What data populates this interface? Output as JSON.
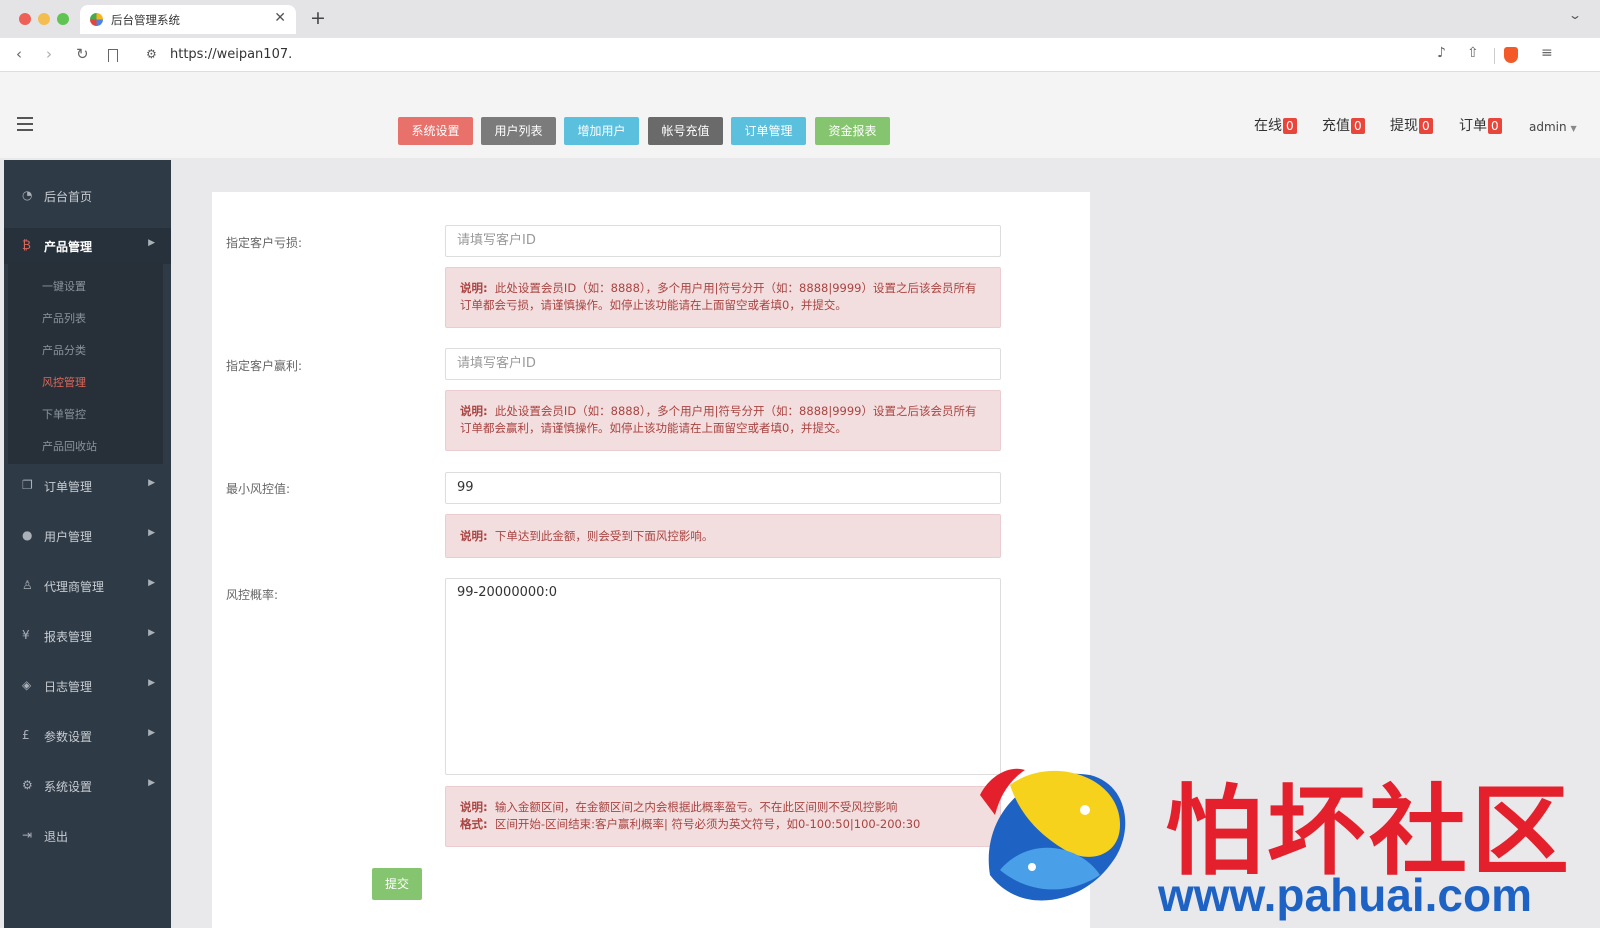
{
  "browser": {
    "tab_title": "后台管理系统",
    "url": "https://weipan107."
  },
  "header": {
    "buttons": [
      {
        "label": "系统设置",
        "color": "#e8716b"
      },
      {
        "label": "用户列表",
        "color": "#7b7b7b"
      },
      {
        "label": "增加用户",
        "color": "#5bc0de"
      },
      {
        "label": "帐号充值",
        "color": "#6a6a6a"
      },
      {
        "label": "订单管理",
        "color": "#5bc0de"
      },
      {
        "label": "资金报表",
        "color": "#86c56f"
      }
    ],
    "counters": [
      {
        "label": "在线",
        "count": "0"
      },
      {
        "label": "充值",
        "count": "0"
      },
      {
        "label": "提现",
        "count": "0"
      },
      {
        "label": "订单",
        "count": "0"
      }
    ],
    "user": "admin"
  },
  "sidebar": {
    "home": "后台首页",
    "product": "产品管理",
    "product_sub": [
      "一键设置",
      "产品列表",
      "产品分类",
      "风控管理",
      "下单管控",
      "产品回收站"
    ],
    "items": [
      "订单管理",
      "用户管理",
      "代理商管理",
      "报表管理",
      "日志管理",
      "参数设置",
      "系统设置"
    ],
    "logout": "退出"
  },
  "form": {
    "loss_label": "指定客户亏损:",
    "loss_placeholder": "请填写客户ID",
    "loss_note_title": "说明:",
    "loss_note": "此处设置会员ID（如：8888），多个用户用|符号分开（如：8888|9999）设置之后该会员所有订单都会亏损，请谨慎操作。如停止该功能请在上面留空或者填0，并提交。",
    "profit_label": "指定客户赢利:",
    "profit_placeholder": "请填写客户ID",
    "profit_note_title": "说明:",
    "profit_note": "此处设置会员ID（如：8888），多个用户用|符号分开（如：8888|9999）设置之后该会员所有订单都会赢利，请谨慎操作。如停止该功能请在上面留空或者填0，并提交。",
    "min_label": "最小风控值:",
    "min_value": "99",
    "min_note_title": "说明:",
    "min_note": "下单达到此金额，则会受到下面风控影响。",
    "rate_label": "风控概率:",
    "rate_value": "99-20000000:0",
    "rate_note_title": "说明:",
    "rate_note": "输入金额区间，在金额区间之内会根据此概率盈亏。不在此区间则不受风控影响",
    "rate_format_title": "格式:",
    "rate_format": "区间开始-区间结束:客户赢利概率|       符号必须为英文符号，如0-100:50|100-200:30",
    "submit": "提交"
  },
  "watermark": {
    "text": "怕坏社区",
    "url": "www.pahuai.com"
  }
}
